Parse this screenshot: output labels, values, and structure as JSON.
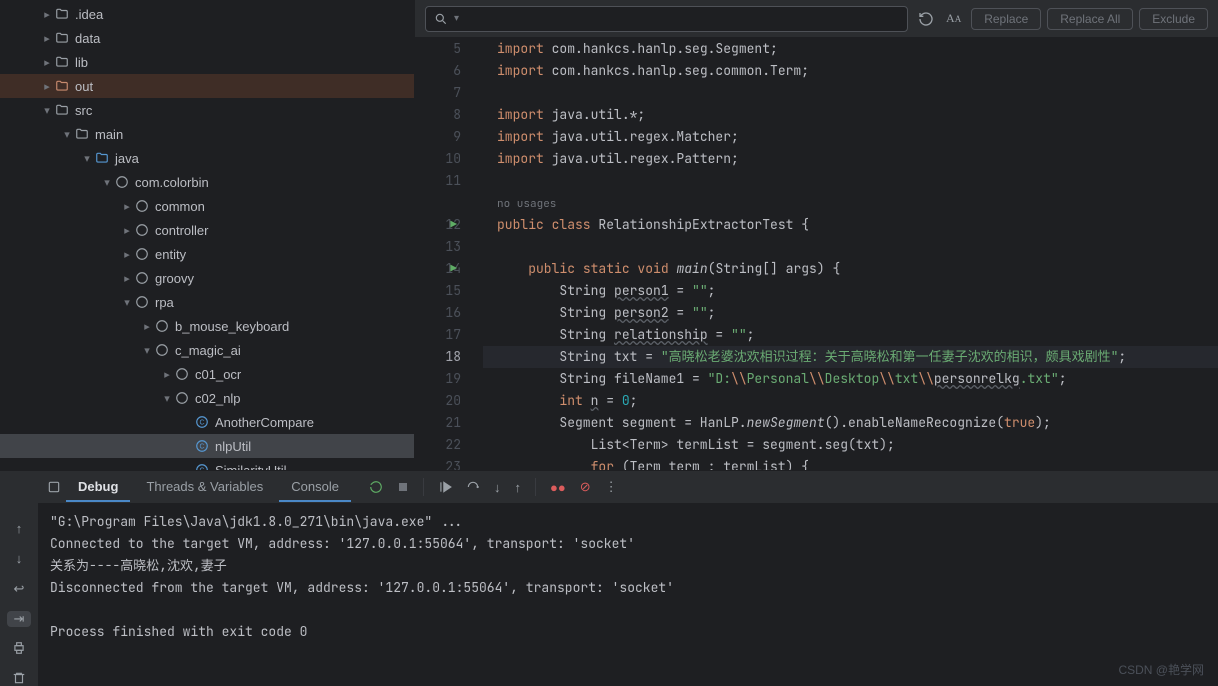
{
  "findbar": {
    "replace": "Replace",
    "replace_all": "Replace All",
    "exclude": "Exclude"
  },
  "tree": [
    {
      "indent": 40,
      "chev": "right",
      "icon": "folder",
      "label": ".idea"
    },
    {
      "indent": 40,
      "chev": "right",
      "icon": "folder",
      "label": "data"
    },
    {
      "indent": 40,
      "chev": "right",
      "icon": "folder",
      "label": "lib"
    },
    {
      "indent": 40,
      "chev": "right",
      "icon": "folder-orange",
      "label": "out",
      "excluded": true
    },
    {
      "indent": 40,
      "chev": "down",
      "icon": "folder",
      "label": "src"
    },
    {
      "indent": 60,
      "chev": "down",
      "icon": "folder",
      "label": "main"
    },
    {
      "indent": 80,
      "chev": "down",
      "icon": "folder-blue",
      "label": "java"
    },
    {
      "indent": 100,
      "chev": "down",
      "icon": "package",
      "label": "com.colorbin"
    },
    {
      "indent": 120,
      "chev": "right",
      "icon": "package",
      "label": "common"
    },
    {
      "indent": 120,
      "chev": "right",
      "icon": "package",
      "label": "controller"
    },
    {
      "indent": 120,
      "chev": "right",
      "icon": "package",
      "label": "entity"
    },
    {
      "indent": 120,
      "chev": "right",
      "icon": "package",
      "label": "groovy"
    },
    {
      "indent": 120,
      "chev": "down",
      "icon": "package",
      "label": "rpa"
    },
    {
      "indent": 140,
      "chev": "right",
      "icon": "package",
      "label": "b_mouse_keyboard"
    },
    {
      "indent": 140,
      "chev": "down",
      "icon": "package",
      "label": "c_magic_ai"
    },
    {
      "indent": 160,
      "chev": "right",
      "icon": "package",
      "label": "c01_ocr"
    },
    {
      "indent": 160,
      "chev": "down",
      "icon": "package",
      "label": "c02_nlp"
    },
    {
      "indent": 180,
      "chev": "",
      "icon": "class",
      "label": "AnotherCompare"
    },
    {
      "indent": 180,
      "chev": "",
      "icon": "class",
      "label": "nlpUtil",
      "selected": true
    },
    {
      "indent": 180,
      "chev": "",
      "icon": "class",
      "label": "SimilarityUtil"
    }
  ],
  "editor": {
    "hint_no_usages": "no usages",
    "lines": [
      {
        "n": 5,
        "tokens": [
          [
            "kw",
            "import"
          ],
          [
            "ident",
            " com.hankcs.hanlp.seg.Segment;"
          ]
        ]
      },
      {
        "n": 6,
        "tokens": [
          [
            "kw",
            "import"
          ],
          [
            "ident",
            " com.hankcs.hanlp.seg.common.Term;"
          ]
        ]
      },
      {
        "n": 7,
        "tokens": []
      },
      {
        "n": 8,
        "tokens": [
          [
            "kw",
            "import"
          ],
          [
            "ident",
            " java.util.*;"
          ]
        ]
      },
      {
        "n": 9,
        "tokens": [
          [
            "kw",
            "import"
          ],
          [
            "ident",
            " java.util.regex.Matcher;"
          ]
        ]
      },
      {
        "n": 10,
        "tokens": [
          [
            "kw",
            "import"
          ],
          [
            "ident",
            " java.util.regex.Pattern;"
          ]
        ]
      },
      {
        "n": 11,
        "tokens": []
      },
      {
        "n": "hint"
      },
      {
        "n": 12,
        "run": true,
        "tokens": [
          [
            "kw",
            "public "
          ],
          [
            "kw",
            "class"
          ],
          [
            "ident",
            " RelationshipExtractorTest {"
          ]
        ]
      },
      {
        "n": 13,
        "tokens": []
      },
      {
        "n": 14,
        "run": true,
        "tokens": [
          [
            "ident",
            "    "
          ],
          [
            "kw",
            "public "
          ],
          [
            "kw",
            "static "
          ],
          [
            "kw",
            "void "
          ],
          [
            "mtd",
            "main"
          ],
          [
            "ident",
            "(String[] args) {"
          ]
        ]
      },
      {
        "n": 15,
        "tokens": [
          [
            "ident",
            "        String "
          ],
          [
            "under",
            "person1"
          ],
          [
            "ident",
            " = "
          ],
          [
            "str",
            "\"\""
          ],
          [
            "ident",
            ";"
          ]
        ]
      },
      {
        "n": 16,
        "tokens": [
          [
            "ident",
            "        String "
          ],
          [
            "under",
            "person2"
          ],
          [
            "ident",
            " = "
          ],
          [
            "str",
            "\"\""
          ],
          [
            "ident",
            ";"
          ]
        ]
      },
      {
        "n": 17,
        "tokens": [
          [
            "ident",
            "        String "
          ],
          [
            "under",
            "relationship"
          ],
          [
            "ident",
            " = "
          ],
          [
            "str",
            "\"\""
          ],
          [
            "ident",
            ";"
          ]
        ]
      },
      {
        "n": 18,
        "hl": true,
        "tokens": [
          [
            "ident",
            "        String txt = "
          ],
          [
            "str",
            "\"高晓松老婆沈欢相识过程：关于高晓松和第一任妻子沈欢的相识，颇具戏剧性\""
          ],
          [
            "ident",
            ";"
          ]
        ]
      },
      {
        "n": 19,
        "tokens": [
          [
            "ident",
            "        String fileName1 = "
          ],
          [
            "str",
            "\"D:"
          ],
          [
            "kw",
            "\\\\"
          ],
          [
            "str",
            "Personal"
          ],
          [
            "kw",
            "\\\\"
          ],
          [
            "str",
            "Desktop"
          ],
          [
            "kw",
            "\\\\"
          ],
          [
            "str",
            "txt"
          ],
          [
            "kw",
            "\\\\"
          ],
          [
            "under",
            "personrelkg"
          ],
          [
            "str",
            ".txt\""
          ],
          [
            "ident",
            ";"
          ]
        ]
      },
      {
        "n": 20,
        "tokens": [
          [
            "ident",
            "        "
          ],
          [
            "kw",
            "int "
          ],
          [
            "under",
            "n"
          ],
          [
            "ident",
            " = "
          ],
          [
            "num",
            "0"
          ],
          [
            "ident",
            ";"
          ]
        ]
      },
      {
        "n": 21,
        "tokens": [
          [
            "ident",
            "        Segment segment = HanLP."
          ],
          [
            "mtd",
            "newSegment"
          ],
          [
            "ident",
            "().enableNameRecognize("
          ],
          [
            "kw",
            "true"
          ],
          [
            "ident",
            ");"
          ]
        ]
      },
      {
        "n": 22,
        "tokens": [
          [
            "ident",
            "            List<Term> termList = segment.seg(txt);"
          ]
        ]
      },
      {
        "n": 23,
        "tokens": [
          [
            "ident",
            "            "
          ],
          [
            "kw",
            "for"
          ],
          [
            "ident",
            " (Term term : termList) {"
          ]
        ]
      }
    ]
  },
  "debug": {
    "tab_debug": "Debug",
    "tab_threads": "Threads & Variables",
    "tab_console": "Console"
  },
  "console_lines": [
    "\"G:\\Program Files\\Java\\jdk1.8.0_271\\bin\\java.exe\" ...",
    "Connected to the target VM, address: '127.0.0.1:55064', transport: 'socket'",
    "关系为----高晓松,沈欢,妻子",
    "Disconnected from the target VM, address: '127.0.0.1:55064', transport: 'socket'",
    "",
    "Process finished with exit code 0"
  ],
  "watermark": "CSDN @艳学网"
}
